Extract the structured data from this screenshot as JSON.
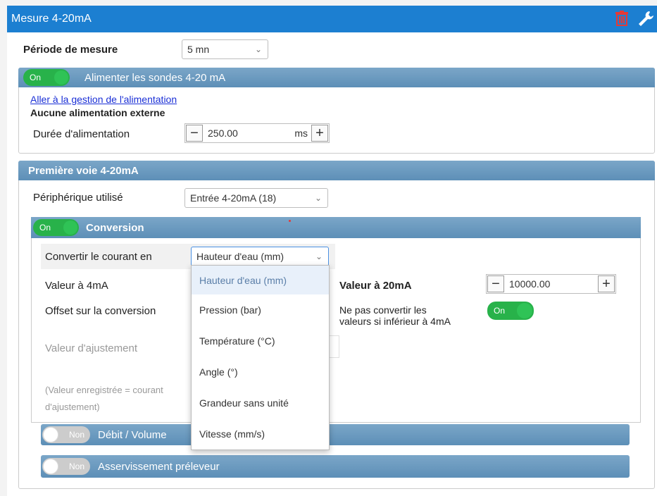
{
  "header": {
    "title": "Mesure 4-20mA"
  },
  "periode": {
    "label": "Période de mesure",
    "value": "5 mn"
  },
  "alim": {
    "toggle": "On",
    "title": "Alimenter les sondes 4-20 mA",
    "link": "Aller à la gestion de l'alimentation",
    "info": "Aucune alimentation externe",
    "duree_label": "Durée d'alimentation",
    "duree_value": "250.00",
    "duree_unit": "ms"
  },
  "voie": {
    "title": "Première voie 4-20mA",
    "periph_label": "Périphérique utilisé",
    "periph_value": "Entrée 4-20mA (18)"
  },
  "conversion": {
    "toggle": "On",
    "title": "Conversion",
    "convertir_label": "Convertir le courant en",
    "convertir_value": "Hauteur d'eau (mm)",
    "valeur4_label": "Valeur à 4mA",
    "valeur20_label": "Valeur à 20mA",
    "valeur20_value": "10000.00",
    "offset_label": "Offset sur la conversion",
    "ne_pas_line1": "Ne pas convertir les",
    "ne_pas_line2": "valeurs si inférieur à 4mA",
    "ne_pas_toggle": "On",
    "ajustement_label": "Valeur d'ajustement",
    "formula_line1": "(Valeur enregistrée = courant",
    "formula_line2": "d'ajustement)"
  },
  "dropdown": {
    "options": [
      "Hauteur d'eau (mm)",
      "Pression (bar)",
      "Température (°C)",
      "Angle (°)",
      "Grandeur sans unité",
      "Vitesse (mm/s)"
    ]
  },
  "debit": {
    "toggle": "Non",
    "title": "Débit / Volume"
  },
  "asserv": {
    "toggle": "Non",
    "title": "Asservissement préleveur"
  },
  "colors": {
    "header_blue": "#1c7fd1",
    "toggle_green": "#28b24a",
    "section_blue": "#6a9ac0",
    "trash_red": "#e53935"
  },
  "icons": {
    "trash": "trash-icon",
    "wrench": "wrench-icon"
  }
}
